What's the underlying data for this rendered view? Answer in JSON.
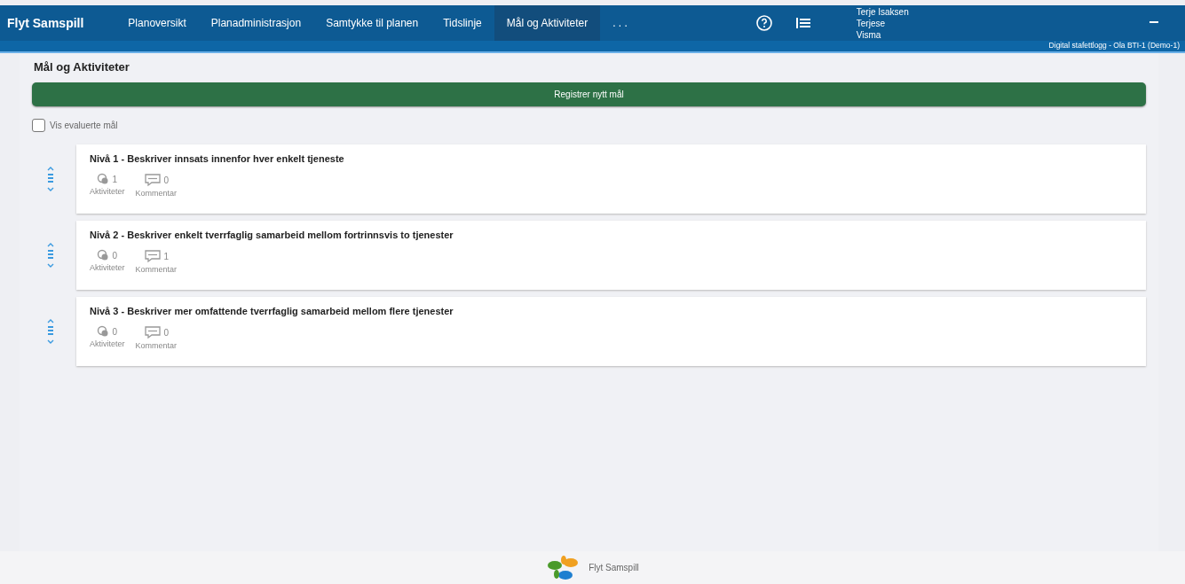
{
  "app_title": "Flyt Samspill",
  "nav": [
    {
      "label": "Planoversikt",
      "selected": false
    },
    {
      "label": "Planadministrasjon",
      "selected": false
    },
    {
      "label": "Samtykke til planen",
      "selected": false
    },
    {
      "label": "Tidslinje",
      "selected": false
    },
    {
      "label": "Mål og Aktiviteter",
      "selected": true
    },
    {
      "label": ". . .",
      "selected": false
    }
  ],
  "user": {
    "lines": [
      "Terje Isaksen",
      "Terjese",
      "Visma"
    ],
    "context": "Digital stafettlogg - Ola BTI-1 (Demo-1)"
  },
  "page_title": "Mål og Aktiviteter",
  "register_button": "Registrer nytt mål",
  "show_evaluated": {
    "label": "Vis evaluerte mål",
    "checked": false
  },
  "goals": [
    {
      "title": "Nivå 1 - Beskriver innsats innenfor hver enkelt tjeneste",
      "activities": "1",
      "activities_label": "Aktiviteter",
      "comments": "0",
      "comments_label": "Kommentar"
    },
    {
      "title": "Nivå 2 - Beskriver enkelt tverrfaglig samarbeid mellom fortrinnsvis to tjenester",
      "activities": "0",
      "activities_label": "Aktiviteter",
      "comments": "1",
      "comments_label": "Kommentar"
    },
    {
      "title": "Nivå 3 - Beskriver mer omfattende tverrfaglig samarbeid mellom flere tjenester",
      "activities": "0",
      "activities_label": "Aktiviteter",
      "comments": "0",
      "comments_label": "Kommentar"
    }
  ],
  "footer": {
    "label": "Flyt Samspill"
  }
}
